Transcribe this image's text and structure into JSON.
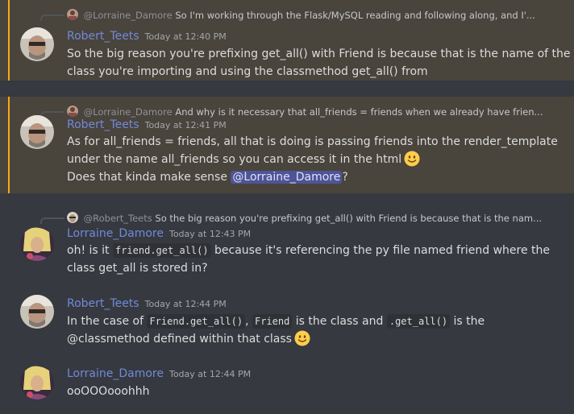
{
  "messages": [
    {
      "reply": {
        "user": "@Lorraine_Damore",
        "text": "So I'm working through the Flask/MySQL reading and following along, and I'..."
      },
      "user": "Robert_Teets",
      "time": "Today at 12:40 PM",
      "lines": [
        "So the big reason you're prefixing get_all() with Friend is because that is the name of the",
        "class you're importing and using the classmethod get_all() from"
      ]
    },
    {
      "reply": {
        "user": "@Lorraine_Damore",
        "text": "And why is it necessary that all_friends = friends when we already have frien..."
      },
      "user": "Robert_Teets",
      "time": "Today at 12:41 PM",
      "lines": [
        "As for all_friends = friends, all that is doing is passing friends into the render_template",
        "under the name all_friends so you can access it in the html"
      ],
      "followup": {
        "before": "Does that kinda make sense ",
        "mention": "@Lorraine_Damore",
        "after": "?"
      }
    },
    {
      "reply": {
        "user": "@Robert_Teets",
        "text": "So the big reason you're prefixing get_all() with Friend is because that is the nam..."
      },
      "user": "Lorraine_Damore",
      "time": "Today at 12:43 PM",
      "line1": {
        "before": "oh! is it ",
        "code": "friend.get_all()",
        "after": " because it's referencing the py file named friend where the"
      },
      "line2": "class get_all is stored in?"
    },
    {
      "user": "Robert_Teets",
      "time": "Today at 12:44 PM",
      "line1": {
        "before": "In the case of ",
        "code1": "Friend.get_all()",
        "mid1": ", ",
        "code2": "Friend",
        "mid2": " is the class and ",
        "code3": ".get_all()",
        "after": " is the"
      },
      "line2": "@classmethod defined within that class"
    },
    {
      "user": "Lorraine_Damore",
      "time": "Today at 12:44 PM",
      "lines": [
        "ooOOOooohhh"
      ]
    }
  ],
  "emoji": "slightly-smiling-face-icon",
  "colors": {
    "background": "#36393f",
    "highlight": "#49443c",
    "highlight_bar": "#faa81a",
    "username": "#7289da",
    "text": "#dcddde",
    "mention": "#4e5496"
  }
}
